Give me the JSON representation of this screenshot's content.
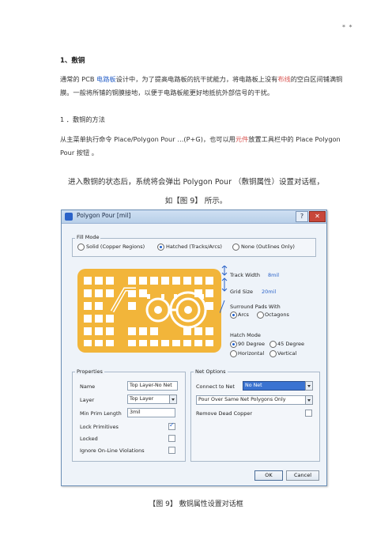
{
  "header_mark": "* *",
  "section_title": "1、敷铜",
  "para1_parts": [
    "通常的 PCB ",
    "电路板",
    "设计中，为了提高电路板的抗干扰能力，将电路板上没有",
    "布线",
    "的空白区间铺满铜膜。一般将所铺的铜膜接地，以便于电路板能更好地抵抗外部信号的干扰。"
  ],
  "subsection": "1 ．敷铜的方法",
  "para2_parts": [
    "从主菜单执行命令 Place/Polygon Pour …(P+G)，也可以用",
    "元件",
    "放置工具栏中的 Place Polygon Pour 按钮 。"
  ],
  "center_line1": "进入敷铜的状态后，系统将会弹出 Polygon Pour （敷铜属性）设置对话框，",
  "center_line2": "如【图 9】 所示。",
  "dialog": {
    "title": "Polygon Pour [mil]",
    "help": "?",
    "close": "✕",
    "fill_mode": {
      "legend": "Fill Mode",
      "options": [
        "Solid (Copper Regions)",
        "Hatched (Tracks/Arcs)",
        "None (Outlines Only)"
      ],
      "selected": "Hatched (Tracks/Arcs)"
    },
    "track_width_label": "Track Width",
    "track_width_value": "8mil",
    "grid_size_label": "Grid Size",
    "grid_size_value": "20mil",
    "surround_label": "Surround Pads With",
    "surround_options": [
      "Arcs",
      "Octagons"
    ],
    "surround_selected": "Arcs",
    "hatch_label": "Hatch Mode",
    "hatch_options": [
      "90 Degree",
      "45 Degree",
      "Horizontal",
      "Vertical"
    ],
    "hatch_selected": "90 Degree",
    "properties": {
      "legend": "Properties",
      "name_label": "Name",
      "name_value": "Top Layer-No Net",
      "layer_label": "Layer",
      "layer_value": "Top Layer",
      "min_prim_label": "Min Prim Length",
      "min_prim_value": "3mil",
      "lock_label": "Lock Primitives",
      "lock_checked": true,
      "locked_label": "Locked",
      "locked_checked": false,
      "ignore_label": "Ignore On-Line Violations",
      "ignore_checked": false
    },
    "net_options": {
      "legend": "Net Options",
      "connect_label": "Connect to Net",
      "connect_value": "No Net",
      "pour_value": "Pour Over Same Net Polygons Only",
      "remove_label": "Remove Dead Copper",
      "remove_checked": false
    },
    "ok": "OK",
    "cancel": "Cancel"
  },
  "caption": "【图 9】 敷铜属性设置对话框",
  "colors": {
    "copper": "#f2b53a",
    "link": "#2a62c8",
    "dialog_bg": "#eef3f9"
  }
}
